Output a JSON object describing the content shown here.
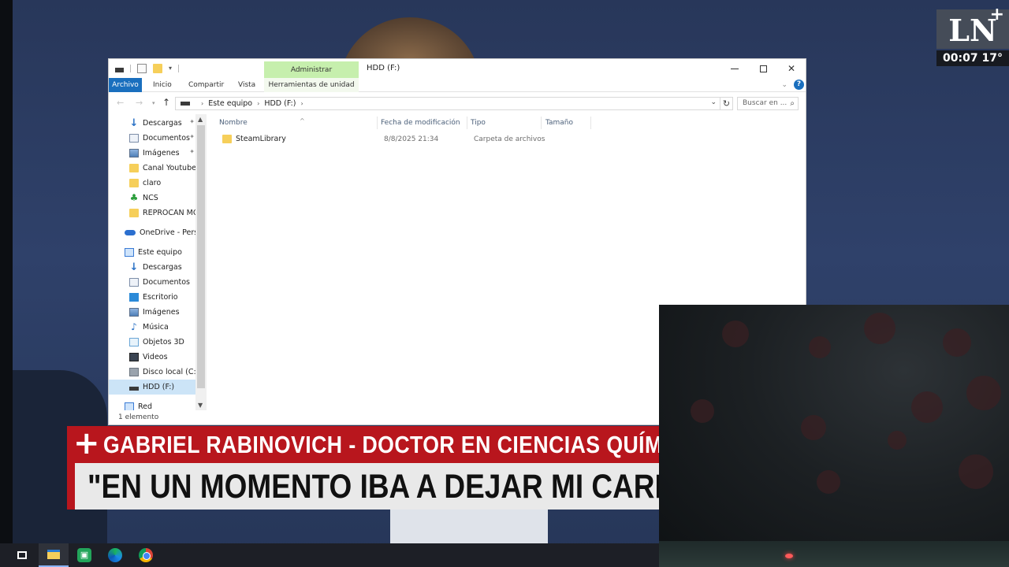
{
  "channel": {
    "logo": "LN",
    "plus": "+",
    "time_temp": "00:07 17°"
  },
  "explorer": {
    "admin_tab": "Administrar",
    "window_title": "HDD (F:)",
    "ribbon_tabs": [
      "Archivo",
      "Inicio",
      "Compartir",
      "Vista",
      "Herramientas de unidad"
    ],
    "breadcrumb": [
      "Este equipo",
      "HDD (F:)"
    ],
    "search_placeholder": "Buscar en ...",
    "nav_items": [
      {
        "label": "Descargas",
        "icon": "download-icon",
        "pinned": true
      },
      {
        "label": "Documentos",
        "icon": "document-icon",
        "pinned": true
      },
      {
        "label": "Imágenes",
        "icon": "pictures-icon",
        "pinned": true
      },
      {
        "label": "Canal Youtube",
        "icon": "folder-icon"
      },
      {
        "label": "claro",
        "icon": "folder-icon"
      },
      {
        "label": "NCS",
        "icon": "ncs-icon"
      },
      {
        "label": "REPROCAN MOI",
        "icon": "folder-icon"
      },
      {
        "label": "OneDrive - Persor",
        "icon": "onedrive-icon"
      },
      {
        "label": "Este equipo",
        "icon": "this-pc-icon"
      },
      {
        "label": "Descargas",
        "icon": "download-icon"
      },
      {
        "label": "Documentos",
        "icon": "document-icon"
      },
      {
        "label": "Escritorio",
        "icon": "desktop-icon"
      },
      {
        "label": "Imágenes",
        "icon": "pictures-icon"
      },
      {
        "label": "Música",
        "icon": "music-icon"
      },
      {
        "label": "Objetos 3D",
        "icon": "3d-objects-icon"
      },
      {
        "label": "Videos",
        "icon": "videos-icon"
      },
      {
        "label": "Disco local (C:)",
        "icon": "local-disk-icon"
      },
      {
        "label": "HDD (F:)",
        "icon": "hdd-icon",
        "selected": true
      },
      {
        "label": "Red",
        "icon": "network-icon"
      }
    ],
    "columns": [
      "Nombre",
      "Fecha de modificación",
      "Tipo",
      "Tamaño"
    ],
    "files": [
      {
        "name": "SteamLibrary",
        "modified": "8/8/2025 21:34",
        "type": "Carpeta de archivos",
        "size": ""
      }
    ],
    "status": "1 elemento"
  },
  "lower_third": {
    "plus": "+",
    "name": "GABRIEL RABINOVICH - DOCTOR EN CIENCIAS QUÍMICAS",
    "quote": "\"EN UN MOMENTO IBA A DEJAR MI CARRERA\""
  },
  "colors": {
    "accent_blue": "#1a6fbe",
    "admin_green": "#c6efad",
    "lower_third_red": "#b8161d",
    "selection": "#cce4f7"
  }
}
